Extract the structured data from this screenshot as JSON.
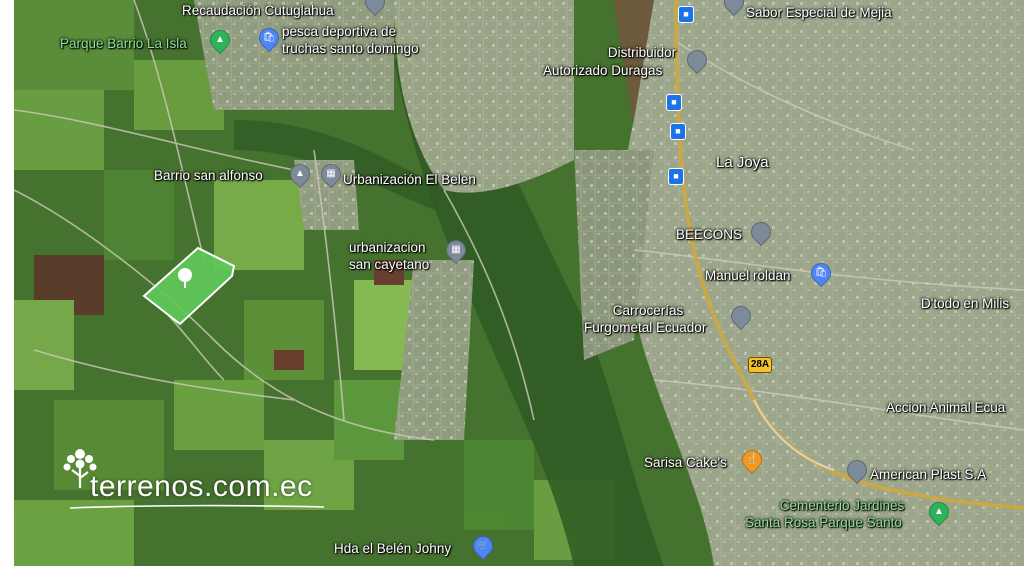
{
  "map": {
    "places": {
      "recaudacion": "Recaudación Cutuglahua",
      "pesca_line1": "pesca deportiva de",
      "pesca_line2": "truchas santo domingo",
      "parque_barrio": "Parque Barrio La Isla",
      "sabor": "Sabor Especial de Mejia",
      "distribuidor_line1": "Distribuidor",
      "distribuidor_line2": "Autorizado Duragas",
      "la_joya": "La Joya",
      "barrio_san_alfonso": "Barrio san alfonso",
      "urb_el_belen": "Urbanización El Belen",
      "beecons": "BEECONS",
      "urb_cayetano_line1": "urbanizacion",
      "urb_cayetano_line2": "san cayetano",
      "manuel_roldan": "Manuel roldan",
      "dtodo": "D'todo en Milis",
      "carrocerias_line1": "Carrocerías",
      "carrocerias_line2": "Furgometal Ecuador",
      "accion_animal": "Accion Animal Ecua",
      "sarisa": "Sarisa Cake's",
      "american_plast": "American Plast S.A",
      "cementerio_line1": "Cementerio Jardines",
      "cementerio_line2": "Santa Rosa Parque Santo",
      "hda_belen": "Hda el Belén Johny"
    },
    "route_shield": "28A",
    "brand": "terrenos.com.ec",
    "colors": {
      "parcel": "#5fc85a",
      "road": "#c9a84a",
      "label_green": "#8fe39a"
    },
    "icons": [
      "pin-grey-icon",
      "education-icon",
      "government-icon",
      "shopping-icon",
      "restaurant-icon",
      "park-icon",
      "bus-stop-icon",
      "tree-logo-icon"
    ]
  }
}
